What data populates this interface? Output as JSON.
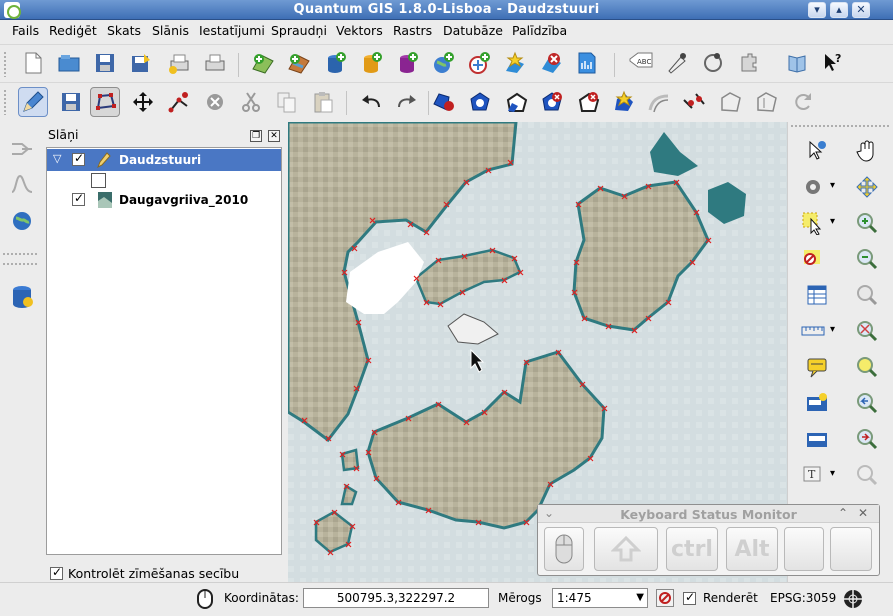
{
  "window": {
    "title": "Quantum GIS 1.8.0-Lisboa - Daudzstuuri",
    "buttons": [
      "chevron-down-icon",
      "chevron-up-icon",
      "close-icon"
    ]
  },
  "menu": [
    {
      "label": "Fails"
    },
    {
      "label": "Rediģēt"
    },
    {
      "label": "Skats"
    },
    {
      "label": "Slānis"
    },
    {
      "label": "Iestatījumi"
    },
    {
      "label": "Spraudņi"
    },
    {
      "label": "Vektors"
    },
    {
      "label": "Rastrs"
    },
    {
      "label": "Datubāze"
    },
    {
      "label": "Palīdzība"
    }
  ],
  "toolbar_file": {
    "icons": [
      "new-project-icon",
      "open-project-icon",
      "save-project-icon",
      "save-as-icon",
      "print-composer-icon",
      "print-icon",
      "add-vector-layer-icon",
      "add-raster-layer-icon",
      "add-postgis-layer-icon",
      "add-spatialite-layer-icon",
      "add-mssql-layer-icon",
      "add-wms-layer-icon",
      "add-wfs-layer-icon",
      "new-shapefile-layer-icon",
      "remove-layer-icon",
      "add-delimited-text-icon",
      "label-icon",
      "digitizing-tools-icon",
      "node-tool-icon",
      "plugin-icon",
      "help-book-icon",
      "whats-this-icon"
    ]
  },
  "toolbar_edit": {
    "icons": [
      "toggle-editing-icon",
      "save-edits-icon",
      "node-tool-icon",
      "move-feature-icon",
      "add-vertex-icon",
      "delete-selected-icon",
      "cut-features-icon",
      "copy-features-icon",
      "paste-features-icon",
      "undo-icon",
      "redo-icon",
      "simplify-feature-icon",
      "add-ring-icon",
      "add-part-icon",
      "delete-ring-icon",
      "delete-part-icon",
      "reshape-features-icon",
      "offset-curve-icon",
      "split-features-icon",
      "merge-features-icon",
      "merge-attributes-icon",
      "rotate-point-symbols-icon"
    ]
  },
  "layers_panel": {
    "title": "Slāņi",
    "layers": [
      {
        "name": "Daudzstuuri",
        "checked": true,
        "selected": true,
        "icon": "pencil-edit-icon"
      },
      {
        "name": "",
        "checked": false,
        "selected": false,
        "icon": "polygon-symbol-icon"
      },
      {
        "name": "Daugavgriiva_2010",
        "checked": true,
        "selected": false,
        "icon": "raster-layer-icon"
      }
    ],
    "draw_order_label": "Kontrolēt zīmēšanas secību",
    "draw_order_checked": true
  },
  "left_dock_icons": [
    "ai-merge-icon",
    "histogram-icon",
    "globe-icon",
    "database-icon"
  ],
  "right_toolbar": {
    "icons": [
      "identify-icon",
      "pan-icon",
      "action-gear-icon",
      "pan-to-selection-icon",
      "select-feature-icon",
      "zoom-in-icon",
      "deselect-icon",
      "zoom-out-icon",
      "attribute-table-icon",
      "zoom-full-icon",
      "measure-icon",
      "zoom-to-selection-icon",
      "map-tips-icon",
      "zoom-to-layer-icon",
      "new-bookmark-icon",
      "zoom-last-icon",
      "show-bookmarks-icon",
      "zoom-next-icon",
      "text-annotation-icon",
      "refresh-icon"
    ]
  },
  "keyboard_monitor": {
    "title": "Keyboard Status Monitor",
    "keys": [
      {
        "label": "",
        "icon": "mouse-icon"
      },
      {
        "label": "",
        "icon": "shift-arrow-icon"
      },
      {
        "label": "ctrl"
      },
      {
        "label": "Alt"
      },
      {
        "label": ""
      },
      {
        "label": ""
      }
    ]
  },
  "statusbar": {
    "coordinates_label": "Koordinātas:",
    "coordinates_value": "500795.3,322297.2",
    "scale_label": "Mērogs",
    "scale_value": "1:475",
    "render_label": "Renderēt",
    "render_checked": true,
    "crs": "EPSG:3059"
  },
  "colors": {
    "title_bar": "#4a7bc0",
    "selected_row": "#4a77c4",
    "land": "#b9b4a0",
    "water": "#d4dde0",
    "vertex_marker": "#e02020"
  }
}
